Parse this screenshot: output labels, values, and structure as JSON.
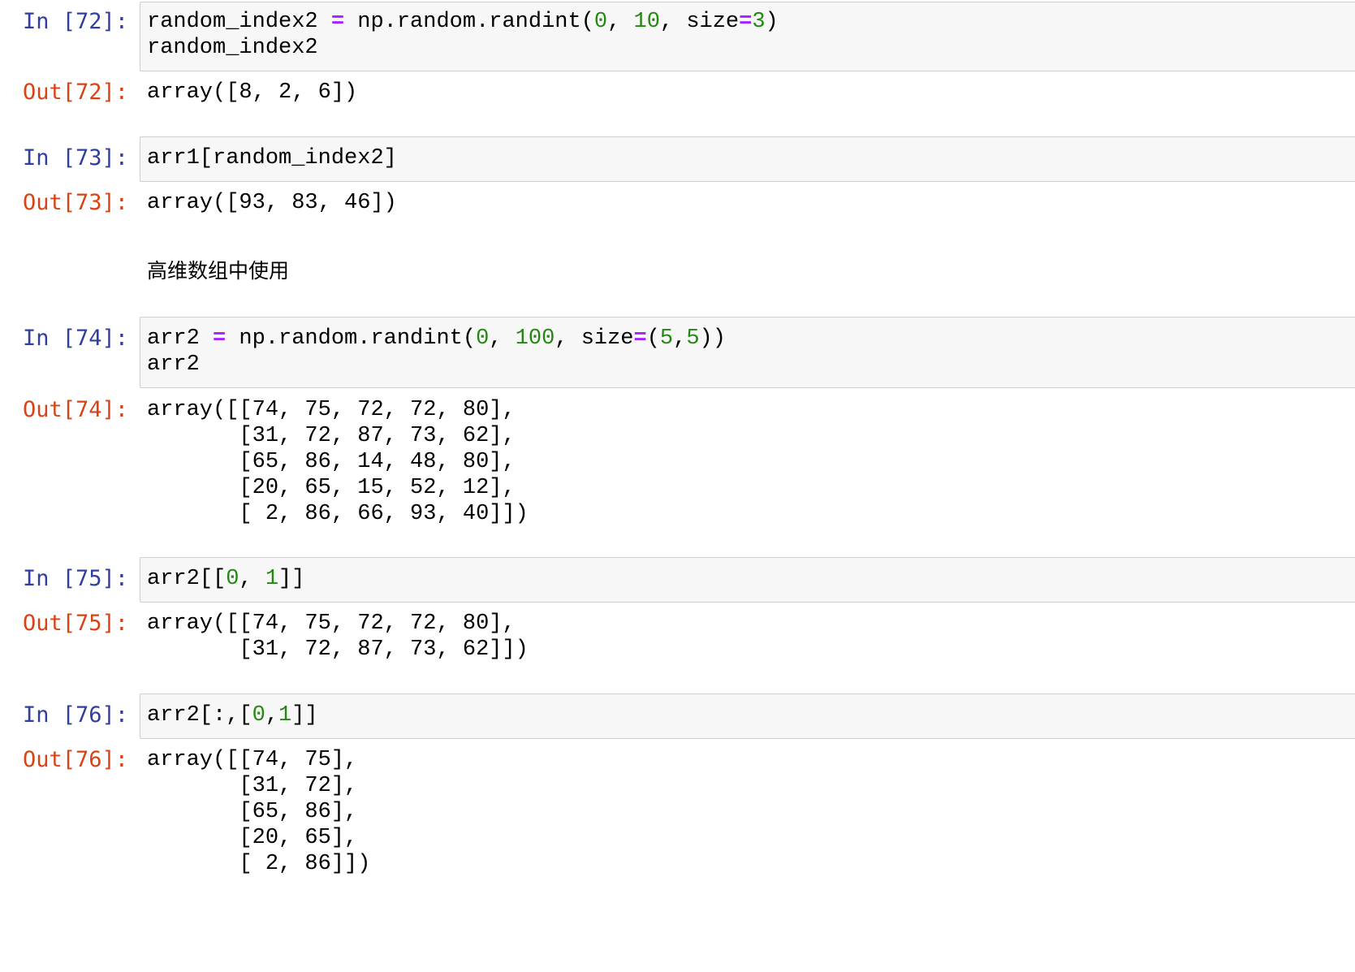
{
  "cells": {
    "c72": {
      "in_prompt": "In [72]:",
      "line1": {
        "a": "random_index2 ",
        "op": "=",
        "b": " np.random.randint(",
        "n1": "0",
        "c": ", ",
        "n2": "10",
        "d": ", size",
        "op2": "=",
        "n3": "3",
        "e": ")"
      },
      "line2": "random_index2",
      "out_prompt": "Out[72]:",
      "output": "array([8, 2, 6])"
    },
    "c73": {
      "in_prompt": "In [73]:",
      "line1": "arr1[random_index2]",
      "out_prompt": "Out[73]:",
      "output": "array([93, 83, 46])"
    },
    "markdown": {
      "text": "高维数组中使用"
    },
    "c74": {
      "in_prompt": "In [74]:",
      "line1": {
        "a": "arr2 ",
        "op": "=",
        "b": " np.random.randint(",
        "n1": "0",
        "c": ", ",
        "n2": "100",
        "d": ", size",
        "op2": "=",
        "e": "(",
        "n3": "5",
        "f": ",",
        "n4": "5",
        "g": "))"
      },
      "line2": "arr2",
      "out_prompt": "Out[74]:",
      "output": [
        "array([[74, 75, 72, 72, 80],",
        "       [31, 72, 87, 73, 62],",
        "       [65, 86, 14, 48, 80],",
        "       [20, 65, 15, 52, 12],",
        "       [ 2, 86, 66, 93, 40]])"
      ]
    },
    "c75": {
      "in_prompt": "In [75]:",
      "line1": {
        "a": "arr2[[",
        "n1": "0",
        "b": ", ",
        "n2": "1",
        "c": "]]"
      },
      "out_prompt": "Out[75]:",
      "output": [
        "array([[74, 75, 72, 72, 80],",
        "       [31, 72, 87, 73, 62]])"
      ]
    },
    "c76": {
      "in_prompt": "In [76]:",
      "line1": {
        "a": "arr2[:,[",
        "n1": "0",
        "b": ",",
        "n2": "1",
        "c": "]]"
      },
      "out_prompt": "Out[76]:",
      "output": [
        "array([[74, 75],",
        "       [31, 72],",
        "       [65, 86],",
        "       [20, 65],",
        "       [ 2, 86]])"
      ]
    }
  },
  "colors": {
    "in_prompt": "#303f9f",
    "out_prompt": "#d84315",
    "operator": "#aa22ff",
    "number": "#228811",
    "input_background": "#f7f7f7",
    "input_border": "#cfcfcf"
  }
}
